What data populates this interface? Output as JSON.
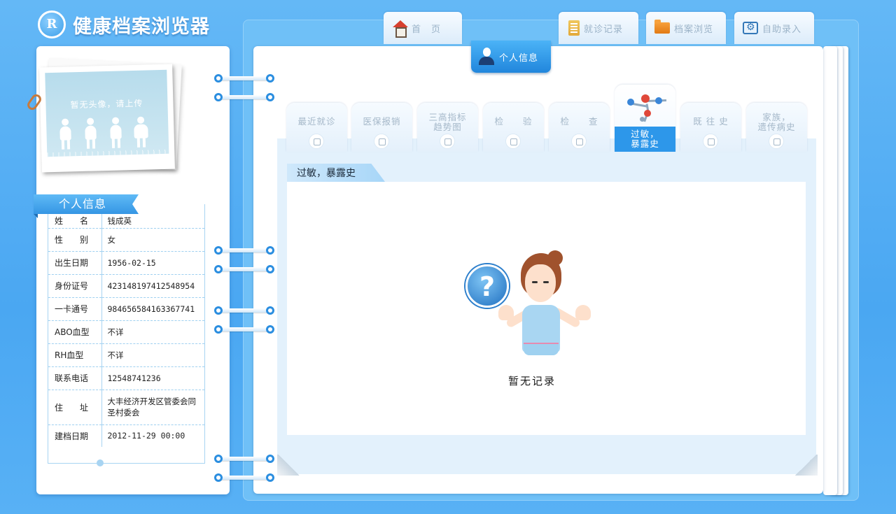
{
  "app": {
    "title": "健康档案浏览器",
    "logo_letter": "R"
  },
  "nav": {
    "home": "首　页",
    "visits": "就诊记录",
    "archive_browse": "档案浏览",
    "self_entry": "自助录入",
    "personal_info": "个人信息"
  },
  "photo": {
    "placeholder": "暂无头像，请上传"
  },
  "profile": {
    "title": "个人信息",
    "rows": [
      {
        "label": "姓　　名",
        "value": "钱成英"
      },
      {
        "label": "性　　别",
        "value": "女"
      },
      {
        "label": "出生日期",
        "value": "1956-02-15"
      },
      {
        "label": "身份证号",
        "value": "423148197412548954"
      },
      {
        "label": "一卡通号",
        "value": "984656584163367741"
      },
      {
        "label": "ABO血型",
        "value": "不详"
      },
      {
        "label": "RH血型",
        "value": "不详"
      },
      {
        "label": "联系电话",
        "value": "12548741236"
      },
      {
        "label": "住　　址",
        "value": "大丰经济开发区管委会同圣村委会"
      },
      {
        "label": "建档日期",
        "value": "2012-11-29 00:00"
      }
    ]
  },
  "subtabs": [
    {
      "label": "最近就诊",
      "icon": "stethoscope-icon"
    },
    {
      "label": "医保报销",
      "icon": "card-icon"
    },
    {
      "label": "三高指标\n趋势图",
      "icon": "trend-chart-icon"
    },
    {
      "label": "检　　验",
      "icon": "microscope-icon"
    },
    {
      "label": "检　　查",
      "icon": "monitor-icon"
    },
    {
      "label": "过敏，\n暴露史",
      "icon": "molecule-icon",
      "active": true
    },
    {
      "label": "既 往 史",
      "icon": "clipboard-icon"
    },
    {
      "label": "家族，\n遗传病史",
      "icon": "pen-icon"
    }
  ],
  "section": {
    "title": "过敏，暴露史"
  },
  "empty_state": {
    "message": "暂无记录",
    "symbol": "?"
  },
  "colors": {
    "accent": "#2d97ea",
    "background": "#4aa7f2",
    "ring": "#2b8ee0"
  }
}
